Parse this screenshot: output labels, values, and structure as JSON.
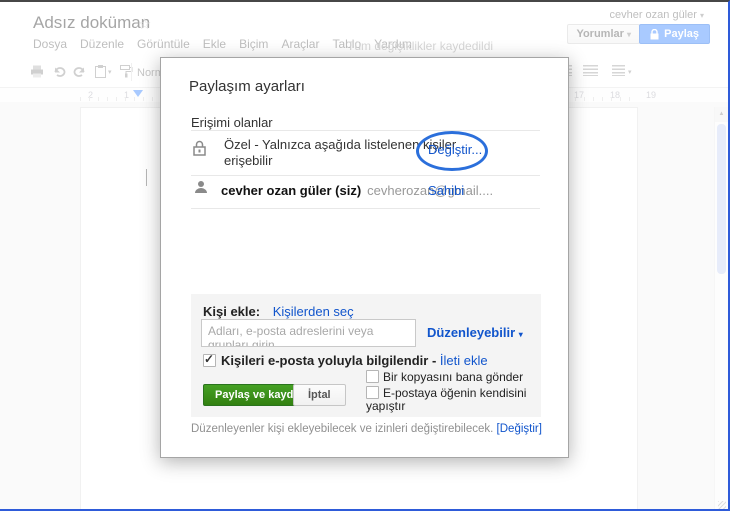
{
  "header": {
    "doc_title": "Adsız doküman",
    "menu_items": [
      "Dosya",
      "Düzenle",
      "Görüntüle",
      "Ekle",
      "Biçim",
      "Araçlar",
      "Tablo",
      "Yardım"
    ],
    "save_status": "Tüm değişiklikler kaydedildi",
    "account_name": "cevher ozan güler",
    "comments_label": "Yorumlar",
    "share_label": "Paylaş"
  },
  "toolbar": {
    "style_value": "Normal"
  },
  "ruler": {
    "left_numbers": [
      "2",
      "1"
    ],
    "right_numbers": [
      "17",
      "18",
      "19"
    ]
  },
  "dialog": {
    "title": "Paylaşım ayarları",
    "access": {
      "heading": "Erişimi olanlar",
      "private_row": {
        "text": "Özel - Yalnızca aşağıda listelenen kişiler erişebilir",
        "change_link": "Değiştir..."
      },
      "owner_row": {
        "name": "cevher ozan güler (siz)",
        "email": "cevherozan@gmail....",
        "role_link": "Sahibi"
      }
    },
    "add_people": {
      "label": "Kişi ekle:",
      "choose_contacts_link": "Kişilerden seç",
      "input_placeholder": "Adları, e-posta adreslerini veya grupları girin...",
      "permission_value": "Düzenleyebilir",
      "notify_label": "Kişileri e-posta yoluyla bilgilendir -",
      "add_message_link": "İleti ekle",
      "send_copy_label": "Bir kopyasını bana gönder",
      "paste_item_label": "E-postaya öğenin kendisini yapıştır",
      "share_save_label": "Paylaş ve kaydet",
      "cancel_label": "İptal"
    },
    "footer_text": "Düzenleyenler kişi ekleyebilecek ve izinleri değiştirebilecek.",
    "footer_link": "[Değiştir]"
  },
  "colors": {
    "accent_blue": "#4d90fe",
    "link_blue": "#1155cc",
    "green_button": "#3d9400",
    "annotation_blue": "#2b6fdb"
  }
}
